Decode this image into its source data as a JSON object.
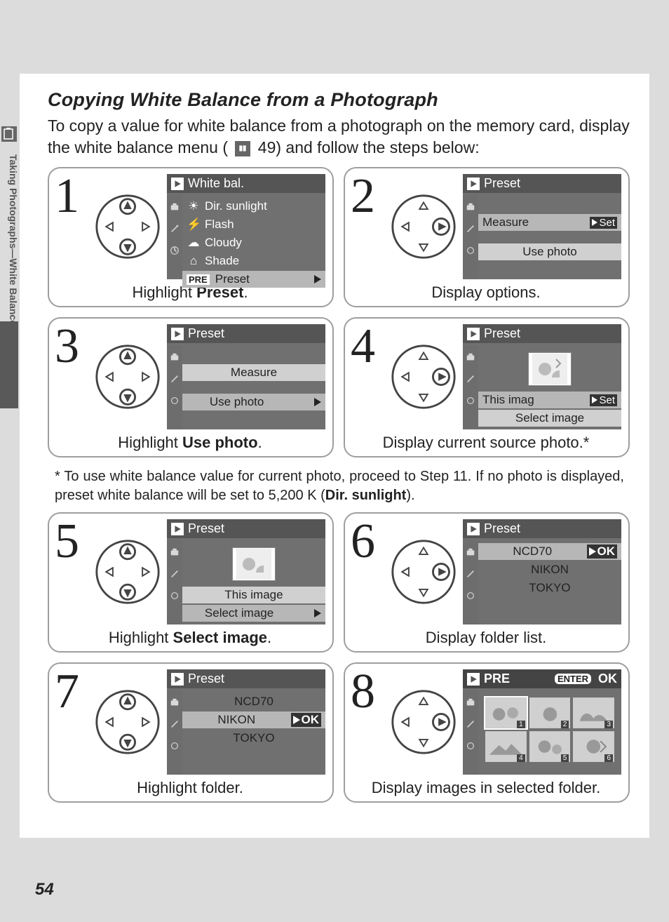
{
  "sidebar_text": "Taking Photographs—White Balance",
  "title": "Copying White Balance from a Photograph",
  "intro_part1": "To copy a value for white balance from a photograph on the memory card, display the white balance menu (",
  "intro_pageref": "49) and follow the steps below:",
  "steps": {
    "s1": {
      "num": "1",
      "hdr": "White bal.",
      "items": [
        "Dir. sunlight",
        "Flash",
        "Cloudy",
        "Shade",
        "Preset"
      ],
      "pre": "PRE",
      "caption_a": "Highlight ",
      "caption_b": "Preset",
      "caption_c": "."
    },
    "s2": {
      "num": "2",
      "hdr": "Preset",
      "measure": "Measure",
      "set": "Set",
      "usephoto": "Use photo",
      "caption": "Display options."
    },
    "s3": {
      "num": "3",
      "hdr": "Preset",
      "measure": "Measure",
      "usephoto": "Use photo",
      "caption_a": "Highlight ",
      "caption_b": "Use photo",
      "caption_c": "."
    },
    "s4": {
      "num": "4",
      "hdr": "Preset",
      "thisimg": "This imag",
      "set": "Set",
      "selimg": "Select image",
      "caption": "Display current source photo.*"
    },
    "s5": {
      "num": "5",
      "hdr": "Preset",
      "thisimg": "This image",
      "selimg": "Select image",
      "caption_a": "Highlight ",
      "caption_b": "Select image",
      "caption_c": "."
    },
    "s6": {
      "num": "6",
      "hdr": "Preset",
      "folders": [
        "NCD70",
        "NIKON",
        "TOKYO"
      ],
      "ok": "OK",
      "caption": "Display folder list."
    },
    "s7": {
      "num": "7",
      "hdr": "Preset",
      "folders": [
        "NCD70",
        "NIKON",
        "TOKYO"
      ],
      "ok": "OK",
      "caption": "Highlight folder."
    },
    "s8": {
      "num": "8",
      "hdr": "PRE",
      "enter": "ENTER",
      "ok": "OK",
      "nums": [
        "1",
        "2",
        "3",
        "4",
        "5",
        "6"
      ],
      "caption": "Display images in selected folder."
    }
  },
  "footnote_a": "* To use white balance value for current photo, proceed to Step 11.  If no photo is displayed, preset white balance will be set to 5,200 K (",
  "footnote_b": "Dir. sunlight",
  "footnote_c": ").",
  "pagenum": "54"
}
